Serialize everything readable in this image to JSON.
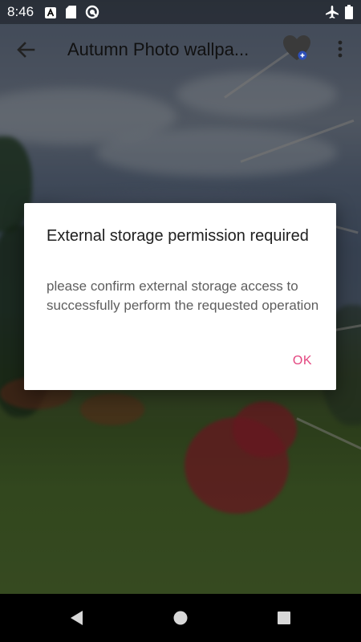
{
  "status_bar": {
    "time": "8:46",
    "left_icons": [
      "android-a-icon",
      "sd-card-icon",
      "sync-circle-icon"
    ],
    "right_icons": [
      "airplane-mode-icon",
      "battery-icon"
    ]
  },
  "toolbar": {
    "title": "Autumn Photo wallpa...",
    "back_icon": "arrow-left-icon",
    "favorite_icon": "heart-icon",
    "more_icon": "more-vertical-icon"
  },
  "dialog": {
    "title": "External storage permission required",
    "message": "please confirm external storage access to successfully perform the requested operation",
    "ok_label": "OK"
  },
  "colors": {
    "accent": "#e3457f",
    "dialog_bg": "#ffffff",
    "nav_bar": "#000000"
  },
  "nav_bar": {
    "icons": [
      "back-triangle-icon",
      "home-circle-icon",
      "recents-square-icon"
    ]
  }
}
